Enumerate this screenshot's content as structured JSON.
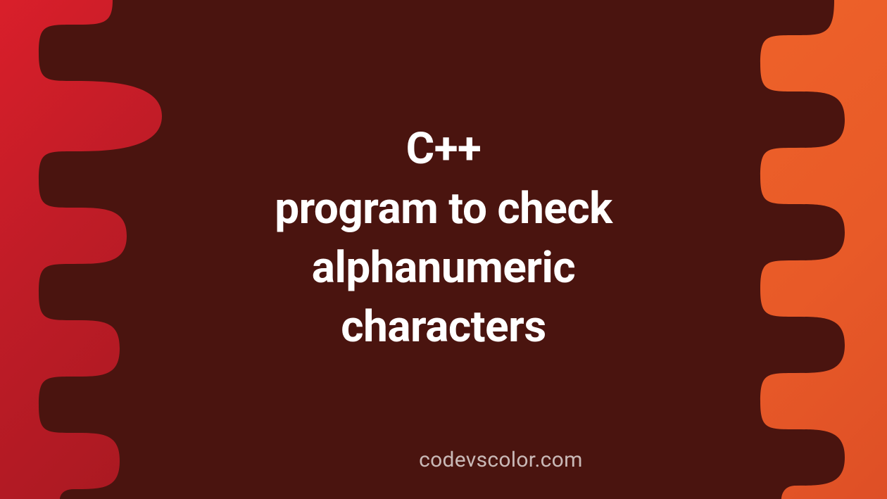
{
  "title": {
    "line1": "C++",
    "line2": "program to check",
    "line3": "alphanumeric",
    "line4": "characters"
  },
  "watermark": "codevscolor.com",
  "colors": {
    "background": "#4a140f",
    "leftGradientStart": "#d91f2a",
    "leftGradientEnd": "#a31820",
    "rightGradientStart": "#f0642a",
    "rightGradientEnd": "#de4f26",
    "textColor": "#ffffff"
  }
}
